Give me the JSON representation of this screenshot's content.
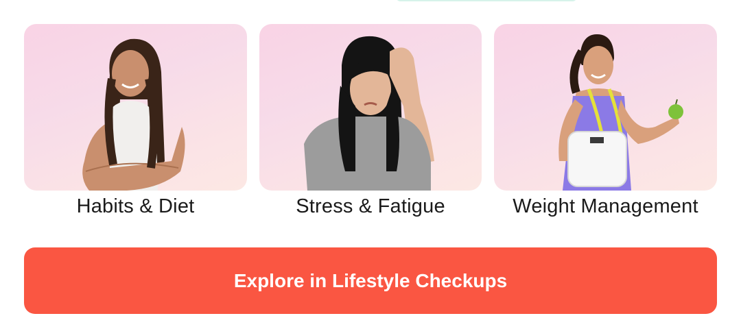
{
  "cards": [
    {
      "label": "Habits & Diet",
      "image": "woman-arms-crossed-photo"
    },
    {
      "label": "Stress & Fatigue",
      "image": "woman-hand-on-head-photo"
    },
    {
      "label": "Weight Management",
      "image": "woman-scale-apple-photo"
    }
  ],
  "cta": {
    "label": "Explore in Lifestyle Checkups"
  },
  "colors": {
    "cta_bg": "#fa5642",
    "card_bg": "#f8d8e8",
    "label_text": "#1a1a1a"
  }
}
